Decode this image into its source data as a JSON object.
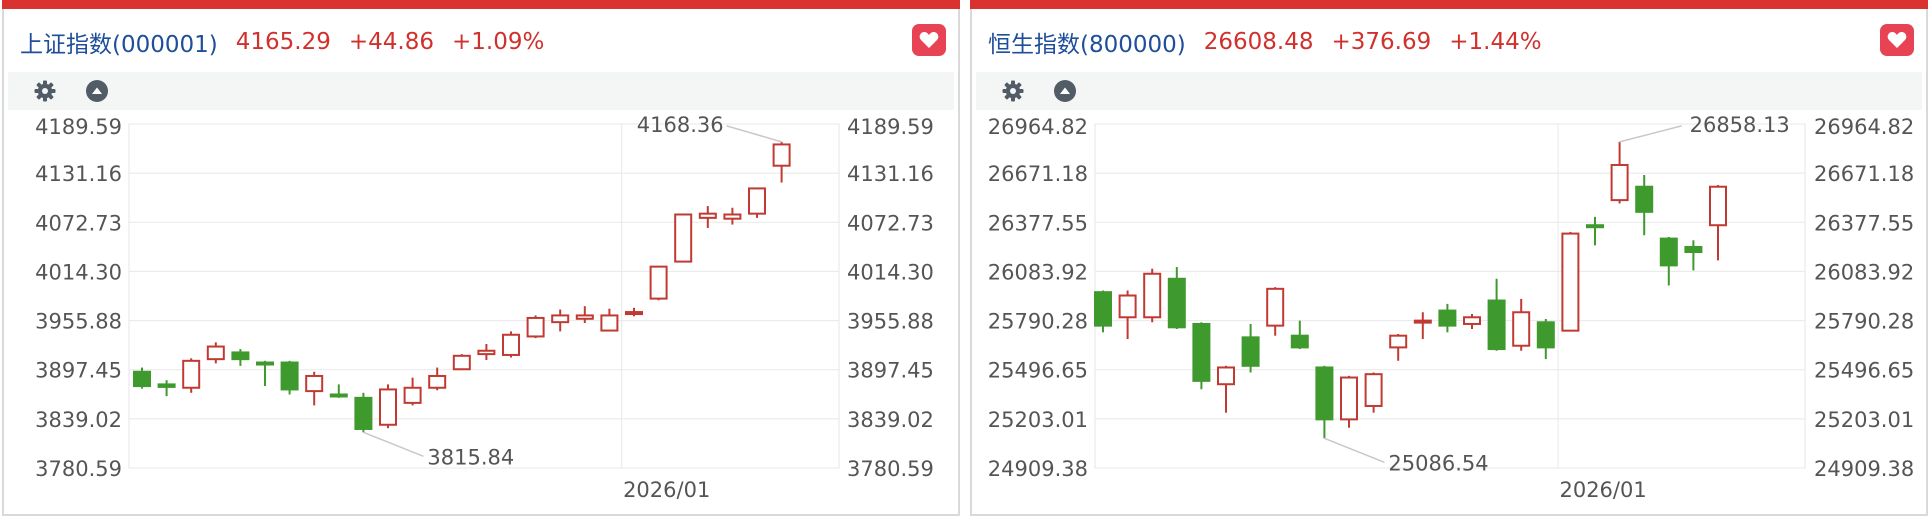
{
  "colors": {
    "up": "#c03a33",
    "down": "#3f9a2e",
    "brand_red": "#d9322f",
    "name_blue": "#1f4e9a"
  },
  "panels": [
    {
      "header": {
        "name": "上证指数(000001)",
        "price": "4165.29",
        "change": "+44.86",
        "pct": "+1.09%"
      },
      "toolbar": {
        "icons": [
          "gear-icon",
          "collapse-up-icon"
        ]
      },
      "favorite_icon": "heart-icon"
    },
    {
      "header": {
        "name": "恒生指数(800000)",
        "price": "26608.48",
        "change": "+376.69",
        "pct": "+1.44%"
      },
      "toolbar": {
        "icons": [
          "gear-icon",
          "collapse-up-icon"
        ]
      },
      "favorite_icon": "heart-icon"
    }
  ],
  "chart_data": [
    {
      "type": "candlestick",
      "y_ticks": [
        "4189.59",
        "4131.16",
        "4072.73",
        "4014.30",
        "3955.88",
        "3897.45",
        "3839.02",
        "3780.59"
      ],
      "ylim": [
        3780.59,
        4189.59
      ],
      "x_tick": {
        "label": "2026/01",
        "index": 20
      },
      "max_label": "4168.36",
      "min_label": "3815.84",
      "candles": [
        {
          "o": 3895,
          "h": 3900,
          "l": 3875,
          "c": 3878
        },
        {
          "o": 3880,
          "h": 3885,
          "l": 3866,
          "c": 3877
        },
        {
          "o": 3876,
          "h": 3911,
          "l": 3870,
          "c": 3908
        },
        {
          "o": 3910,
          "h": 3930,
          "l": 3905,
          "c": 3925
        },
        {
          "o": 3918,
          "h": 3922,
          "l": 3902,
          "c": 3910
        },
        {
          "o": 3906,
          "h": 3908,
          "l": 3878,
          "c": 3904
        },
        {
          "o": 3906,
          "h": 3908,
          "l": 3868,
          "c": 3874
        },
        {
          "o": 3872,
          "h": 3895,
          "l": 3855,
          "c": 3890
        },
        {
          "o": 3868,
          "h": 3880,
          "l": 3864,
          "c": 3867
        },
        {
          "o": 3864,
          "h": 3870,
          "l": 3823,
          "c": 3827
        },
        {
          "o": 3832,
          "h": 3880,
          "l": 3828,
          "c": 3874
        },
        {
          "o": 3858,
          "h": 3888,
          "l": 3855,
          "c": 3876
        },
        {
          "o": 3876,
          "h": 3900,
          "l": 3873,
          "c": 3890
        },
        {
          "o": 3898,
          "h": 3916,
          "l": 3897,
          "c": 3914
        },
        {
          "o": 3916,
          "h": 3928,
          "l": 3909,
          "c": 3920
        },
        {
          "o": 3915,
          "h": 3943,
          "l": 3912,
          "c": 3939
        },
        {
          "o": 3937,
          "h": 3962,
          "l": 3935,
          "c": 3959
        },
        {
          "o": 3954,
          "h": 3969,
          "l": 3943,
          "c": 3962
        },
        {
          "o": 3958,
          "h": 3973,
          "l": 3953,
          "c": 3962
        },
        {
          "o": 3944,
          "h": 3970,
          "l": 3943,
          "c": 3962
        },
        {
          "o": 3964,
          "h": 3971,
          "l": 3961,
          "c": 3966
        },
        {
          "o": 3982,
          "h": 4021,
          "l": 3980,
          "c": 4020
        },
        {
          "o": 4026,
          "h": 4083,
          "l": 4025,
          "c": 4082
        },
        {
          "o": 4078,
          "h": 4092,
          "l": 4066,
          "c": 4083
        },
        {
          "o": 4077,
          "h": 4090,
          "l": 4070,
          "c": 4082
        },
        {
          "o": 4083,
          "h": 4114,
          "l": 4078,
          "c": 4113
        },
        {
          "o": 4140,
          "h": 4168.36,
          "l": 4120,
          "c": 4165.29
        }
      ]
    },
    {
      "type": "candlestick",
      "y_ticks": [
        "26964.82",
        "26671.18",
        "26377.55",
        "26083.92",
        "25790.28",
        "25496.65",
        "25203.01",
        "24909.38"
      ],
      "ylim": [
        24909.38,
        26964.82
      ],
      "x_tick": {
        "label": "2026/01",
        "index": 19
      },
      "max_label": "26858.13",
      "min_label": "25086.54",
      "candles": [
        {
          "o": 25960,
          "h": 25970,
          "l": 25720,
          "c": 25760
        },
        {
          "o": 25810,
          "h": 25970,
          "l": 25680,
          "c": 25940
        },
        {
          "o": 25810,
          "h": 26100,
          "l": 25780,
          "c": 26070
        },
        {
          "o": 26040,
          "h": 26110,
          "l": 25740,
          "c": 25750
        },
        {
          "o": 25770,
          "h": 25780,
          "l": 25380,
          "c": 25430
        },
        {
          "o": 25410,
          "h": 25520,
          "l": 25240,
          "c": 25510
        },
        {
          "o": 25690,
          "h": 25770,
          "l": 25480,
          "c": 25520
        },
        {
          "o": 25760,
          "h": 25990,
          "l": 25700,
          "c": 25980
        },
        {
          "o": 25700,
          "h": 25790,
          "l": 25620,
          "c": 25630
        },
        {
          "o": 25510,
          "h": 25520,
          "l": 25086.54,
          "c": 25200
        },
        {
          "o": 25200,
          "h": 25460,
          "l": 25150,
          "c": 25450
        },
        {
          "o": 25280,
          "h": 25480,
          "l": 25240,
          "c": 25470
        },
        {
          "o": 25630,
          "h": 25710,
          "l": 25550,
          "c": 25700
        },
        {
          "o": 25780,
          "h": 25840,
          "l": 25680,
          "c": 25790
        },
        {
          "o": 25850,
          "h": 25890,
          "l": 25720,
          "c": 25760
        },
        {
          "o": 25770,
          "h": 25830,
          "l": 25740,
          "c": 25810
        },
        {
          "o": 25910,
          "h": 26040,
          "l": 25610,
          "c": 25620
        },
        {
          "o": 25640,
          "h": 25920,
          "l": 25610,
          "c": 25840
        },
        {
          "o": 25780,
          "h": 25800,
          "l": 25560,
          "c": 25630
        },
        {
          "o": 25730,
          "h": 26320,
          "l": 25730,
          "c": 26310
        },
        {
          "o": 26360,
          "h": 26410,
          "l": 26240,
          "c": 26350
        },
        {
          "o": 26510,
          "h": 26858.13,
          "l": 26490,
          "c": 26720
        },
        {
          "o": 26590,
          "h": 26660,
          "l": 26300,
          "c": 26440
        },
        {
          "o": 26280,
          "h": 26290,
          "l": 26000,
          "c": 26120
        },
        {
          "o": 26230,
          "h": 26270,
          "l": 26090,
          "c": 26200
        },
        {
          "o": 26360,
          "h": 26600,
          "l": 26150,
          "c": 26590
        }
      ]
    }
  ]
}
